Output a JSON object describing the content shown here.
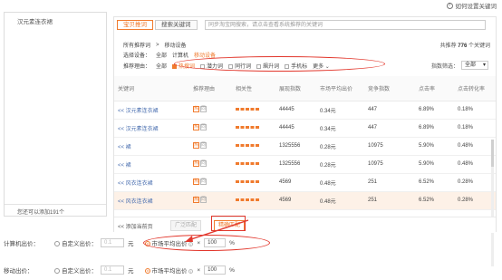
{
  "help": {
    "icon": "question-icon",
    "label": "如何设置关键词"
  },
  "left_panel": {
    "keyword": "汉元素连衣裙",
    "footer": "您还可以添加191个"
  },
  "tabs": [
    {
      "label": "宝贝推词",
      "active": true
    },
    {
      "label": "搜索关键词",
      "active": false
    }
  ],
  "search": {
    "placeholder": "同步淘宝网搜索，请点击查看系统推荐的关键词"
  },
  "breadcrumb": {
    "root": "所有推荐词",
    "sep": ">",
    "current": "移动设备"
  },
  "total": {
    "prefix": "共推荐",
    "count": "776",
    "suffix": "个关键词"
  },
  "device": {
    "label": "选择设备：",
    "options": [
      "全部",
      "计算机",
      "移动设备"
    ],
    "selected": "移动设备"
  },
  "reason": {
    "label": "推荐理由：",
    "all": "全部",
    "options": [
      {
        "label": "热搜词",
        "checked": true
      },
      {
        "label": "潜力词"
      },
      {
        "label": "同行词"
      },
      {
        "label": "飙升词"
      },
      {
        "label": "手机标"
      }
    ],
    "more": "更多"
  },
  "sort_filter": {
    "label": "指数筛选：",
    "value": "全部"
  },
  "table": {
    "headers": [
      "关键词",
      "推荐理由",
      "相关性",
      "展现指数",
      "市场平均出价",
      "竞争指数",
      "点击率",
      "点击转化率"
    ],
    "rows": [
      {
        "keyword": "<< 汉元素连衣裙",
        "tags": [
          "热",
          "同"
        ],
        "impressions": "44445",
        "avg_bid": "0.34元",
        "competition": "447",
        "ctr": "6.89%",
        "cvr": "0.18%"
      },
      {
        "keyword": "<< 汉元素连衣裙",
        "tags": [
          "热",
          "同"
        ],
        "impressions": "44445",
        "avg_bid": "0.34元",
        "competition": "447",
        "ctr": "6.89%",
        "cvr": "0.18%"
      },
      {
        "keyword": "<< 裙",
        "tags": [
          "热",
          "同"
        ],
        "impressions": "1325556",
        "avg_bid": "0.28元",
        "competition": "10975",
        "ctr": "5.90%",
        "cvr": "0.48%"
      },
      {
        "keyword": "<< 裙",
        "tags": [
          "热",
          "同"
        ],
        "impressions": "1325556",
        "avg_bid": "0.28元",
        "competition": "10975",
        "ctr": "5.90%",
        "cvr": "0.48%"
      },
      {
        "keyword": "<< 风衣连衣裙",
        "tags": [
          "热",
          "同"
        ],
        "impressions": "4569",
        "avg_bid": "0.48元",
        "competition": "251",
        "ctr": "6.52%",
        "cvr": "0.28%"
      },
      {
        "keyword": "<< 风衣连衣裙",
        "tags": [
          "热",
          "同"
        ],
        "impressions": "4569",
        "avg_bid": "0.48元",
        "competition": "251",
        "ctr": "6.52%",
        "cvr": "0.28%"
      }
    ]
  },
  "table_footer": {
    "add_page": "<< 添加当前页",
    "broad": "广泛匹配",
    "exact": "精确匹配"
  },
  "pc_bid": {
    "label": "计算机出价：",
    "custom": "自定义出价：",
    "custom_value": "0.1",
    "unit": "元",
    "market": "市场平均出价",
    "times": "×",
    "percent_value": "100",
    "percent": "%"
  },
  "mobile_bid": {
    "label": "移动出价：",
    "custom": "自定义出价：",
    "custom_value": "0.1",
    "unit": "元",
    "market": "市场平均出价",
    "times": "×",
    "percent_value": "100",
    "percent": "%"
  },
  "colors": {
    "accent": "#f07b2e",
    "highlight": "#e2372c"
  }
}
